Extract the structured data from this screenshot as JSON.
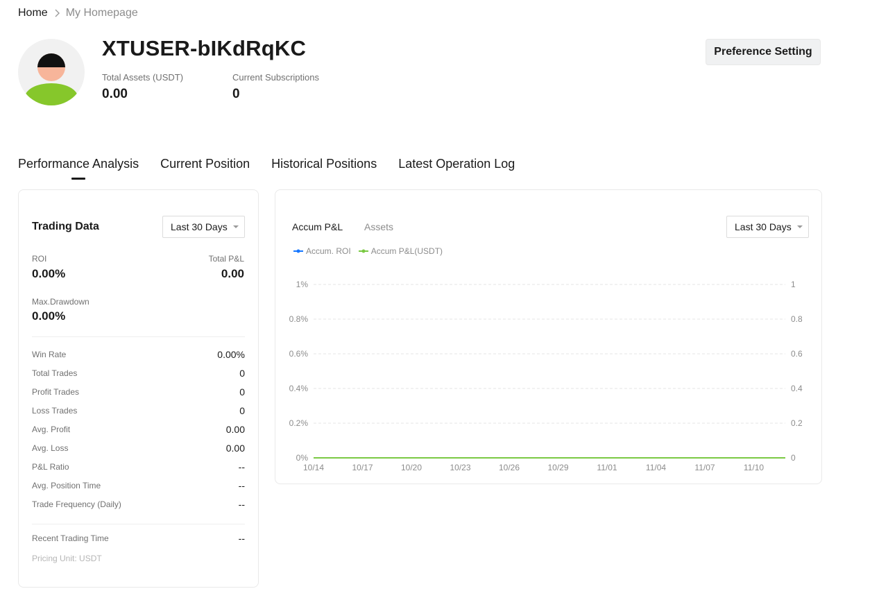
{
  "breadcrumb": {
    "home": "Home",
    "current": "My Homepage"
  },
  "profile": {
    "username": "XTUSER-bIKdRqKC",
    "total_assets_label": "Total Assets (USDT)",
    "total_assets_value": "0.00",
    "subscriptions_label": "Current Subscriptions",
    "subscriptions_value": "0"
  },
  "preference_button": "Preference Setting",
  "tabs": [
    {
      "label": "Performance Analysis",
      "active": true
    },
    {
      "label": "Current Position",
      "active": false
    },
    {
      "label": "Historical Positions",
      "active": false
    },
    {
      "label": "Latest Operation Log",
      "active": false
    }
  ],
  "trading_data": {
    "title": "Trading Data",
    "period_select": "Last 30 Days",
    "roi_label": "ROI",
    "roi_value": "0.00%",
    "total_pnl_label": "Total P&L",
    "total_pnl_value": "0.00",
    "max_drawdown_label": "Max.Drawdown",
    "max_drawdown_value": "0.00%",
    "rows": [
      {
        "label": "Win Rate",
        "value": "0.00%"
      },
      {
        "label": "Total Trades",
        "value": "0"
      },
      {
        "label": "Profit Trades",
        "value": "0"
      },
      {
        "label": "Loss Trades",
        "value": "0"
      },
      {
        "label": "Avg. Profit",
        "value": "0.00"
      },
      {
        "label": "Avg. Loss",
        "value": "0.00"
      },
      {
        "label": "P&L Ratio",
        "value": "--"
      },
      {
        "label": "Avg. Position Time",
        "value": "--"
      },
      {
        "label": "Trade Frequency (Daily)",
        "value": "--"
      }
    ],
    "recent_trading_time_label": "Recent Trading Time",
    "recent_trading_time_value": "--",
    "pricing_unit": "Pricing Unit: USDT"
  },
  "chart_panel": {
    "tabs": [
      {
        "label": "Accum P&L",
        "active": true
      },
      {
        "label": "Assets",
        "active": false
      }
    ],
    "period_select": "Last 30 Days"
  },
  "colors": {
    "roi_series": "#1677ff",
    "pnl_series": "#7ac943",
    "grid": "#e6e6e6"
  },
  "chart_data": {
    "type": "line",
    "x": [
      "10/14",
      "10/17",
      "10/20",
      "10/23",
      "10/26",
      "10/29",
      "11/01",
      "11/04",
      "11/07",
      "11/10"
    ],
    "y_left_ticks": [
      "0%",
      "0.2%",
      "0.4%",
      "0.6%",
      "0.8%",
      "1%"
    ],
    "y_right_ticks": [
      "0",
      "0.2",
      "0.4",
      "0.6",
      "0.8",
      "1"
    ],
    "ylim_left": [
      0,
      1
    ],
    "ylim_right": [
      0,
      1
    ],
    "grid": true,
    "legend_position": "top-left",
    "series": [
      {
        "name": "Accum. ROI",
        "axis": "left",
        "color": "#1677ff",
        "values": [
          0,
          0,
          0,
          0,
          0,
          0,
          0,
          0,
          0,
          0
        ]
      },
      {
        "name": "Accum P&L(USDT)",
        "axis": "right",
        "color": "#7ac943",
        "values": [
          0,
          0,
          0,
          0,
          0,
          0,
          0,
          0,
          0,
          0
        ]
      }
    ]
  }
}
